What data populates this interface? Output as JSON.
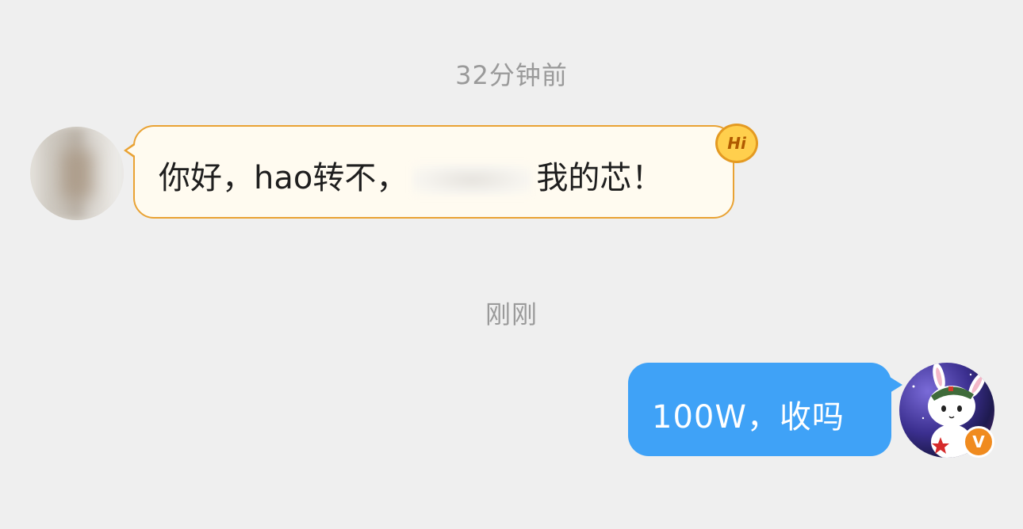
{
  "timestamps": {
    "first": "32分钟前",
    "second": "刚刚"
  },
  "incoming": {
    "text_before": "你好，hao转不，",
    "text_after": "我的芯！",
    "badge": "Hi",
    "avatar_icon": "avatar-blurred"
  },
  "outgoing": {
    "text": "100W，收吗",
    "avatar_icon": "rabbit-avatar-icon",
    "verified_badge": "V"
  },
  "colors": {
    "background": "#efefef",
    "incoming_bubble": "#fffbf0",
    "incoming_border": "#e9a233",
    "outgoing_bubble": "#3fa2f7",
    "timestamp": "#9a9a9a"
  }
}
